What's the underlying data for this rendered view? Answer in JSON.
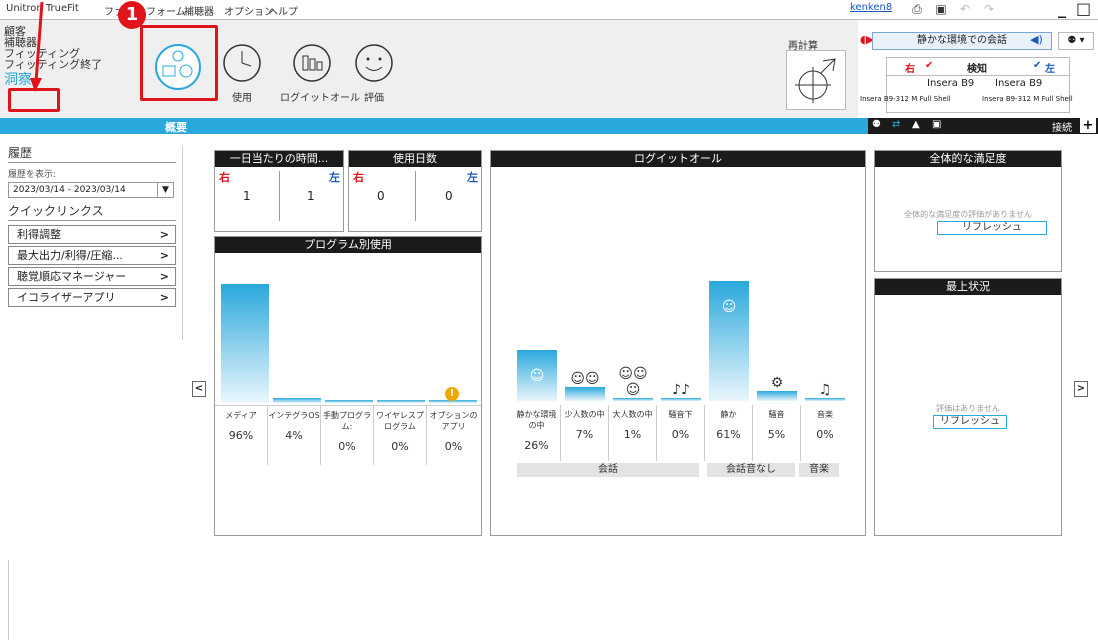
{
  "menubar": {
    "items": [
      "Unitron TrueFit",
      "ファ",
      "フォーム",
      "補聴器",
      "オプション",
      "ヘルプ"
    ],
    "user": "kenken8"
  },
  "nav": {
    "items": [
      "顧客",
      "補聴器",
      "フィッティング",
      "フィッティング終了"
    ],
    "selected": "洞察"
  },
  "callout": "1",
  "toolbar": {
    "usage": "使用",
    "logit": "ログイットオール",
    "eval": "評価",
    "recalc": "再計算"
  },
  "env": {
    "label": "静かな環境での会話"
  },
  "devices": {
    "right": "右",
    "detect": "検知",
    "left": "左",
    "r_model": "Insera B9",
    "l_model": "Insera B9",
    "r_sub": "Insera B9-312 M Full Shell",
    "l_sub": "Insera B9-312 M Full Shell"
  },
  "bluebar": {
    "title": "概要",
    "connect": "接続"
  },
  "sidebar": {
    "history": "履歴",
    "show": "履歴を表示:",
    "date": "2023/03/14 - 2023/03/14",
    "quicklinks": "クイックリンクス",
    "links": [
      "利得調整",
      "最大出力/利得/圧縮...",
      "聴覚順応マネージャー",
      "イコライザーアプリ"
    ]
  },
  "daily": {
    "title": "一日当たりの時間...",
    "right": "右",
    "left": "左",
    "r": "1",
    "l": "1"
  },
  "days": {
    "title": "使用日数",
    "right": "右",
    "left": "左",
    "r": "0",
    "l": "0"
  },
  "programs": {
    "title": "プログラム別使用",
    "items": [
      {
        "label": "メディア",
        "pct": "96%",
        "v": 96
      },
      {
        "label": "インテグラOS",
        "pct": "4%",
        "v": 4
      },
      {
        "label": "手動プログラム:",
        "pct": "0%",
        "v": 0
      },
      {
        "label": "ワイヤレスプログラム",
        "pct": "0%",
        "v": 0
      },
      {
        "label": "オプションのアプリ",
        "pct": "0%",
        "v": 0
      }
    ]
  },
  "logit": {
    "title": "ログイットオール",
    "items": [
      {
        "label": "静かな環境の中",
        "pct": "26%",
        "v": 26
      },
      {
        "label": "少人数の中",
        "pct": "7%",
        "v": 7
      },
      {
        "label": "大人数の中",
        "pct": "1%",
        "v": 1
      },
      {
        "label": "騒音下",
        "pct": "0%",
        "v": 0
      },
      {
        "label": "静か",
        "pct": "61%",
        "v": 61
      },
      {
        "label": "騒音",
        "pct": "5%",
        "v": 5
      },
      {
        "label": "音楽",
        "pct": "0%",
        "v": 0
      }
    ],
    "groups": [
      "会話",
      "会話音なし",
      "音楽"
    ]
  },
  "satisfaction": {
    "title": "全体的な満足度",
    "none": "全体的な満足度の評価がありません",
    "refresh": "リフレッシュ"
  },
  "top": {
    "title": "最上状況",
    "none": "評価はありません",
    "refresh": "リフレッシュ"
  }
}
